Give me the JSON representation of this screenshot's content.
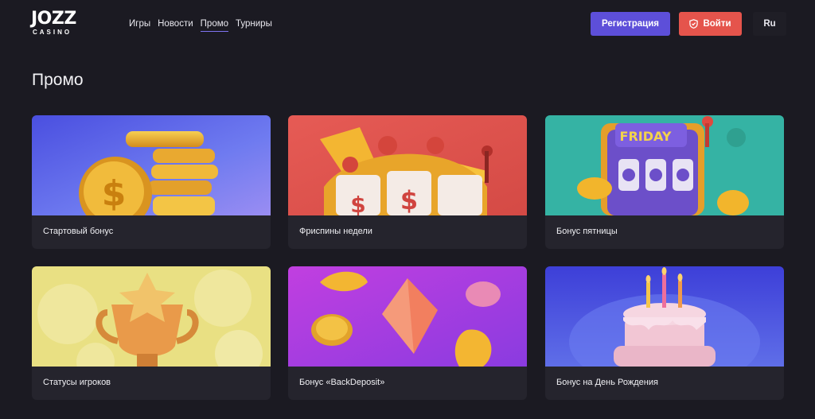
{
  "header": {
    "logo_main": "JOZZ",
    "logo_sub": "CASINO",
    "nav": [
      "Игры",
      "Новости",
      "Промо",
      "Турниры"
    ],
    "active_nav": "Промо",
    "register_label": "Регистрация",
    "login_label": "Войти",
    "language": "Ru"
  },
  "page": {
    "title": "Промо"
  },
  "promos": [
    {
      "label": "Стартовый бонус"
    },
    {
      "label": "Фриспины недели"
    },
    {
      "label": "Бонус пятницы",
      "image_text": "FRIDAY"
    },
    {
      "label": "Статусы игроков"
    },
    {
      "label": "Бонус «BackDeposit»"
    },
    {
      "label": "Бонус на День Рождения"
    }
  ],
  "colors": {
    "background": "#1b1a22",
    "card": "#25242d",
    "register": "#5d4fd9",
    "login": "#e5544c"
  }
}
